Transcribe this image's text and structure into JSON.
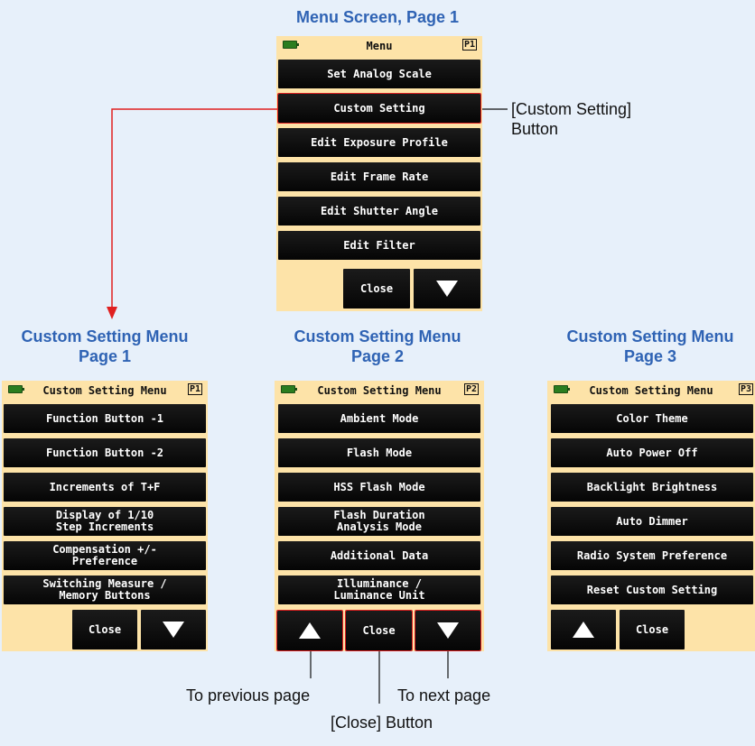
{
  "headings": {
    "menu": "Menu Screen, Page 1",
    "custom1_line1": "Custom Setting Menu",
    "custom1_line2": "Page 1",
    "custom2_line1": "Custom Setting Menu",
    "custom2_line2": "Page 2",
    "custom3_line1": "Custom Setting Menu",
    "custom3_line2": "Page 3"
  },
  "menu_screen": {
    "title": "Menu",
    "page": "P1",
    "buttons": [
      "Set Analog Scale",
      "Custom Setting",
      "Edit Exposure Profile",
      "Edit Frame Rate",
      "Edit Shutter Angle",
      "Edit Filter"
    ],
    "close": "Close",
    "next_icon": "triangle-down-icon"
  },
  "custom_page1": {
    "title": "Custom Setting Menu",
    "page": "P1",
    "buttons": [
      "Function Button -1",
      "Function Button -2",
      "Increments of T+F",
      "Display of 1/10\nStep Increments",
      "Compensation +/-\nPreference",
      "Switching Measure /\nMemory Buttons"
    ],
    "close": "Close",
    "next_icon": "triangle-down-icon"
  },
  "custom_page2": {
    "title": "Custom Setting Menu",
    "page": "P2",
    "buttons": [
      "Ambient Mode",
      "Flash Mode",
      "HSS Flash Mode",
      "Flash Duration\nAnalysis Mode",
      "Additional Data",
      "Illuminance /\n Luminance Unit"
    ],
    "close": "Close",
    "prev_icon": "triangle-up-icon",
    "next_icon": "triangle-down-icon"
  },
  "custom_page3": {
    "title": "Custom Setting Menu",
    "page": "P3",
    "buttons": [
      "Color Theme",
      "Auto Power Off",
      "Backlight Brightness",
      "Auto Dimmer",
      "Radio System Preference",
      "Reset Custom Setting"
    ],
    "close": "Close",
    "prev_icon": "triangle-up-icon"
  },
  "callouts": {
    "custom_setting_button_line1": "[Custom Setting]",
    "custom_setting_button_line2": "Button",
    "to_previous_page": "To previous page",
    "to_next_page": "To next page",
    "close_button": "[Close] Button"
  },
  "colors": {
    "heading": "#2f63b4",
    "panel_background": "#fde3a8",
    "button": "#0b0b0b",
    "highlight_line": "#e02020",
    "page_background": "#e7f0fa"
  }
}
